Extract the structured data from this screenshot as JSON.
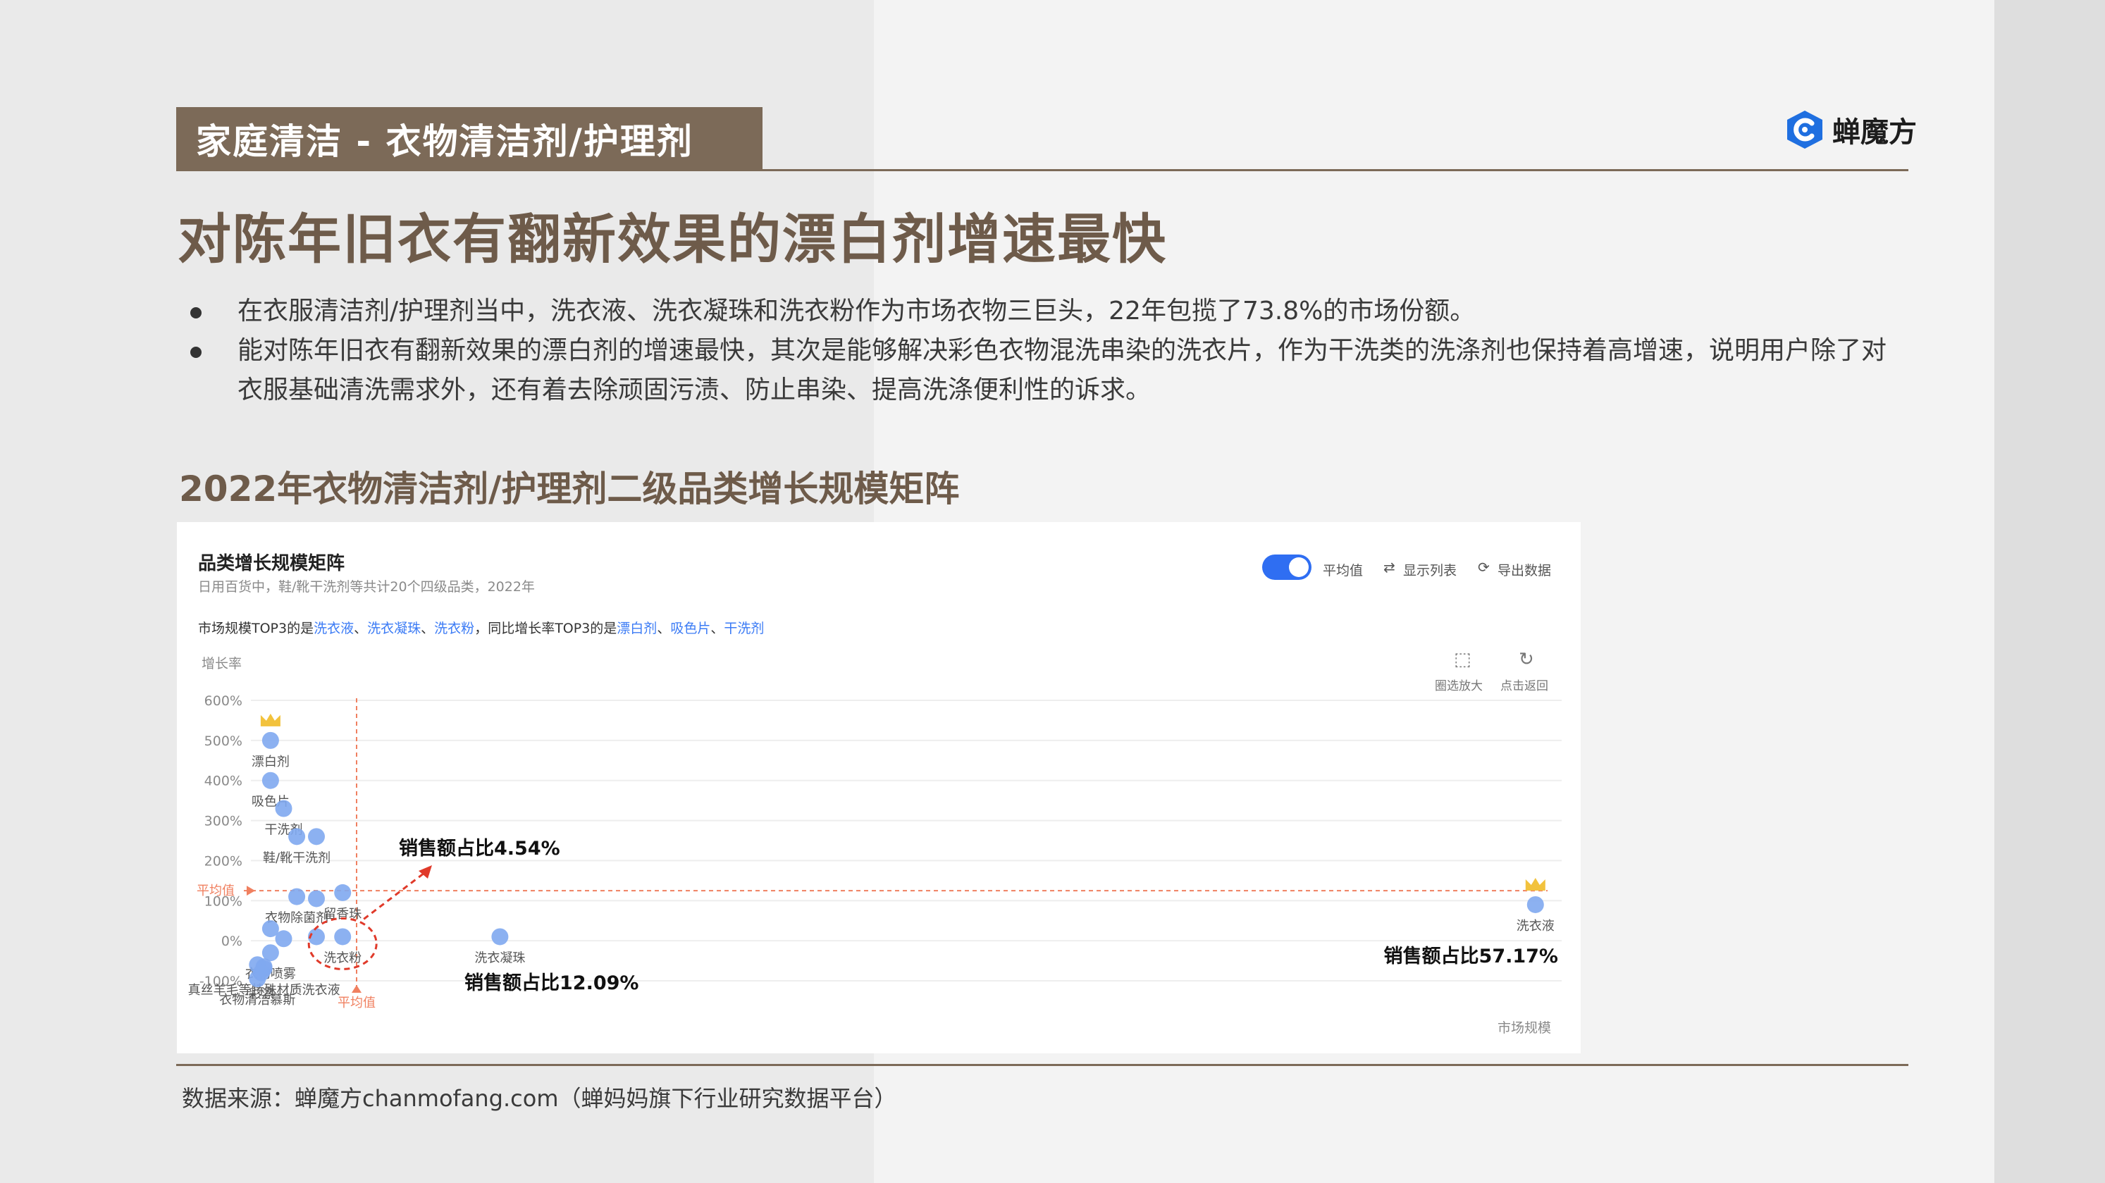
{
  "header": {
    "section_tag": "家庭清洁 - 衣物清洁剂/护理剂",
    "logo_text": "蝉魔方"
  },
  "headline": "对陈年旧衣有翻新效果的漂白剂增速最快",
  "bullets": [
    "在衣服清洁剂/护理剂当中，洗衣液、洗衣凝珠和洗衣粉作为市场衣物三巨头，22年包揽了73.8%的市场份额。",
    "能对陈年旧衣有翻新效果的漂白剂的增速最快，其次是能够解决彩色衣物混洗串染的洗衣片，作为干洗类的洗涤剂也保持着高增速，说明用户除了对衣服基础清洗需求外，还有着去除顽固污渍、防止串染、提高洗涤便利性的诉求。"
  ],
  "chart_section_title": "2022年衣物清洁剂/护理剂二级品类增长规模矩阵",
  "panel": {
    "title": "品类增长规模矩阵",
    "subtitle": "日用百货中，鞋/靴干洗剂等共计20个四级品类，2022年",
    "summary_prefix": "市场规模TOP3的是",
    "summary_size_top3": [
      "洗衣液",
      "洗衣凝珠",
      "洗衣粉"
    ],
    "summary_mid": "，同比增长率TOP3的是",
    "summary_growth_top3": [
      "漂白剂",
      "吸色片",
      "干洗剂"
    ],
    "toolbar": {
      "avg_toggle_label": "平均值",
      "show_list_label": "显示列表",
      "export_label": "导出数据",
      "zoom_label": "圈选放大",
      "reset_label": "点击返回"
    }
  },
  "chart_data": {
    "type": "scatter",
    "title": "品类增长规模矩阵",
    "ylabel": "增长率",
    "xlabel": "市场规模",
    "y_unit": "%",
    "y_ticks": [
      "600%",
      "500%",
      "400%",
      "300%",
      "200%",
      "100%",
      "0%",
      "-100%"
    ],
    "ylim": [
      -100,
      600
    ],
    "xlim": [
      0,
      100
    ],
    "avg_label_y": "平均值",
    "avg_label_x": "平均值",
    "avg_line_color": "#f08060",
    "point_color": "#7fa8ef",
    "points": [
      {
        "name": "漂白剂",
        "x": 1.5,
        "y": 500,
        "crown": true
      },
      {
        "name": "吸色片",
        "x": 1.5,
        "y": 400
      },
      {
        "name": "干洗剂",
        "x": 2.5,
        "y": 330
      },
      {
        "name": "鞋/靴干洗剂",
        "x": 3.5,
        "y": 260
      },
      {
        "name": "",
        "x": 5,
        "y": 260
      },
      {
        "name": "衣物除菌剂",
        "x": 3.5,
        "y": 110
      },
      {
        "name": "",
        "x": 5,
        "y": 105
      },
      {
        "name": "留香珠",
        "x": 7,
        "y": 120
      },
      {
        "name": "",
        "x": 1.5,
        "y": 30
      },
      {
        "name": "",
        "x": 2.5,
        "y": 5
      },
      {
        "name": "",
        "x": 5,
        "y": 10
      },
      {
        "name": "衣物喷雾",
        "x": 1.5,
        "y": -30
      },
      {
        "name": "洗衣粉",
        "x": 7,
        "y": 10
      },
      {
        "name": "",
        "x": 0.5,
        "y": -60
      },
      {
        "name": "",
        "x": 1,
        "y": -65
      },
      {
        "name": "真丝羊毛等特殊材质洗衣液",
        "x": 1,
        "y": -70
      },
      {
        "name": "彩漂",
        "x": 0.8,
        "y": -80
      },
      {
        "name": "衣物清洁慕斯",
        "x": 0.5,
        "y": -95
      },
      {
        "name": "洗衣凝珠",
        "x": 19,
        "y": 10
      },
      {
        "name": "洗衣液",
        "x": 98,
        "y": 90,
        "crown": true
      }
    ],
    "annotations": [
      {
        "text": "销售额占比4.54%",
        "target": "洗衣粉"
      },
      {
        "text": "销售额占比12.09%",
        "target": "洗衣凝珠"
      },
      {
        "text": "销售额占比57.17%",
        "target": "洗衣液"
      }
    ]
  },
  "source": "数据来源：蝉魔方chanmofang.com（蝉妈妈旗下行业研究数据平台）"
}
